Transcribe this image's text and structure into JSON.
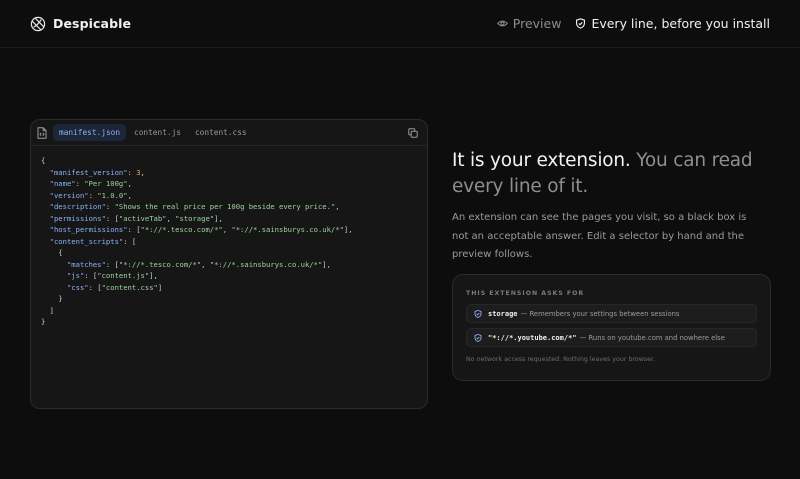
{
  "header": {
    "brand": "Despicable",
    "nav": {
      "preview": "Preview",
      "every_line": "Every line, before you install"
    }
  },
  "code_panel": {
    "tabs": [
      "manifest.json",
      "content.js",
      "content.css"
    ],
    "active_tab": "manifest.json",
    "lines": [
      [
        {
          "t": "p",
          "v": "{"
        }
      ],
      [
        {
          "t": "p",
          "v": "  "
        },
        {
          "t": "k",
          "v": "\"manifest_version\""
        },
        {
          "t": "p",
          "v": ": "
        },
        {
          "t": "n",
          "v": "3"
        },
        {
          "t": "p",
          "v": ","
        }
      ],
      [
        {
          "t": "p",
          "v": "  "
        },
        {
          "t": "k",
          "v": "\"name\""
        },
        {
          "t": "p",
          "v": ": "
        },
        {
          "t": "s",
          "v": "\"Per 100g\""
        },
        {
          "t": "p",
          "v": ","
        }
      ],
      [
        {
          "t": "p",
          "v": "  "
        },
        {
          "t": "k",
          "v": "\"version\""
        },
        {
          "t": "p",
          "v": ": "
        },
        {
          "t": "s",
          "v": "\"1.0.0\""
        },
        {
          "t": "p",
          "v": ","
        }
      ],
      [
        {
          "t": "p",
          "v": "  "
        },
        {
          "t": "k",
          "v": "\"description\""
        },
        {
          "t": "p",
          "v": ": "
        },
        {
          "t": "s",
          "v": "\"Shows the real price per 100g beside every price.\""
        },
        {
          "t": "p",
          "v": ","
        }
      ],
      [
        {
          "t": "p",
          "v": "  "
        },
        {
          "t": "k",
          "v": "\"permissions\""
        },
        {
          "t": "p",
          "v": ": ["
        },
        {
          "t": "s",
          "v": "\"activeTab\""
        },
        {
          "t": "p",
          "v": ", "
        },
        {
          "t": "s",
          "v": "\"storage\""
        },
        {
          "t": "p",
          "v": "],"
        }
      ],
      [
        {
          "t": "p",
          "v": "  "
        },
        {
          "t": "k",
          "v": "\"host_permissions\""
        },
        {
          "t": "p",
          "v": ": ["
        },
        {
          "t": "s",
          "v": "\"*://*.tesco.com/*\""
        },
        {
          "t": "p",
          "v": ", "
        },
        {
          "t": "s",
          "v": "\"*://*.sainsburys.co.uk/*\""
        },
        {
          "t": "p",
          "v": "],"
        }
      ],
      [
        {
          "t": "p",
          "v": "  "
        },
        {
          "t": "k",
          "v": "\"content_scripts\""
        },
        {
          "t": "p",
          "v": ": ["
        }
      ],
      [
        {
          "t": "p",
          "v": "    {"
        }
      ],
      [
        {
          "t": "p",
          "v": "      "
        },
        {
          "t": "k",
          "v": "\"matches\""
        },
        {
          "t": "p",
          "v": ": ["
        },
        {
          "t": "s",
          "v": "\"*://*.tesco.com/*\""
        },
        {
          "t": "p",
          "v": ", "
        },
        {
          "t": "s",
          "v": "\"*://*.sainsburys.co.uk/*\""
        },
        {
          "t": "p",
          "v": "],"
        }
      ],
      [
        {
          "t": "p",
          "v": "      "
        },
        {
          "t": "k",
          "v": "\"js\""
        },
        {
          "t": "p",
          "v": ": ["
        },
        {
          "t": "s",
          "v": "\"content.js\""
        },
        {
          "t": "p",
          "v": "],"
        }
      ],
      [
        {
          "t": "p",
          "v": "      "
        },
        {
          "t": "k",
          "v": "\"css\""
        },
        {
          "t": "p",
          "v": ": ["
        },
        {
          "t": "s",
          "v": "\"content.css\""
        },
        {
          "t": "p",
          "v": "]"
        }
      ],
      [
        {
          "t": "p",
          "v": "    }"
        }
      ],
      [
        {
          "t": "p",
          "v": "  ]"
        }
      ],
      [
        {
          "t": "p",
          "v": "}"
        }
      ]
    ]
  },
  "hero": {
    "headline_strong": "It is your extension.",
    "headline_muted": " You can read every line of it.",
    "description": "An extension can see the pages you visit, so a black box is not an acceptable answer. Edit a selector by hand and the preview follows."
  },
  "permissions_card": {
    "title": "THIS EXTENSION ASKS FOR",
    "items": [
      {
        "code": "storage",
        "text": "— Remembers your settings between sessions"
      },
      {
        "code": "\"*://*.youtube.com/*\"",
        "text": "— Runs on youtube.com and nowhere else"
      }
    ],
    "footnote": "No network access requested. Nothing leaves your browser."
  },
  "colors": {
    "background": "#0d0d0d",
    "accent_blue": "#8ab4f8",
    "string_green": "#9fd49c",
    "number_orange": "#f0a35e"
  },
  "icons": {
    "brand": "globe-icon",
    "preview": "eye-icon",
    "every_line": "shield-icon",
    "file": "file-code-icon",
    "copy": "copy-icon",
    "permission": "shield-check-icon"
  }
}
